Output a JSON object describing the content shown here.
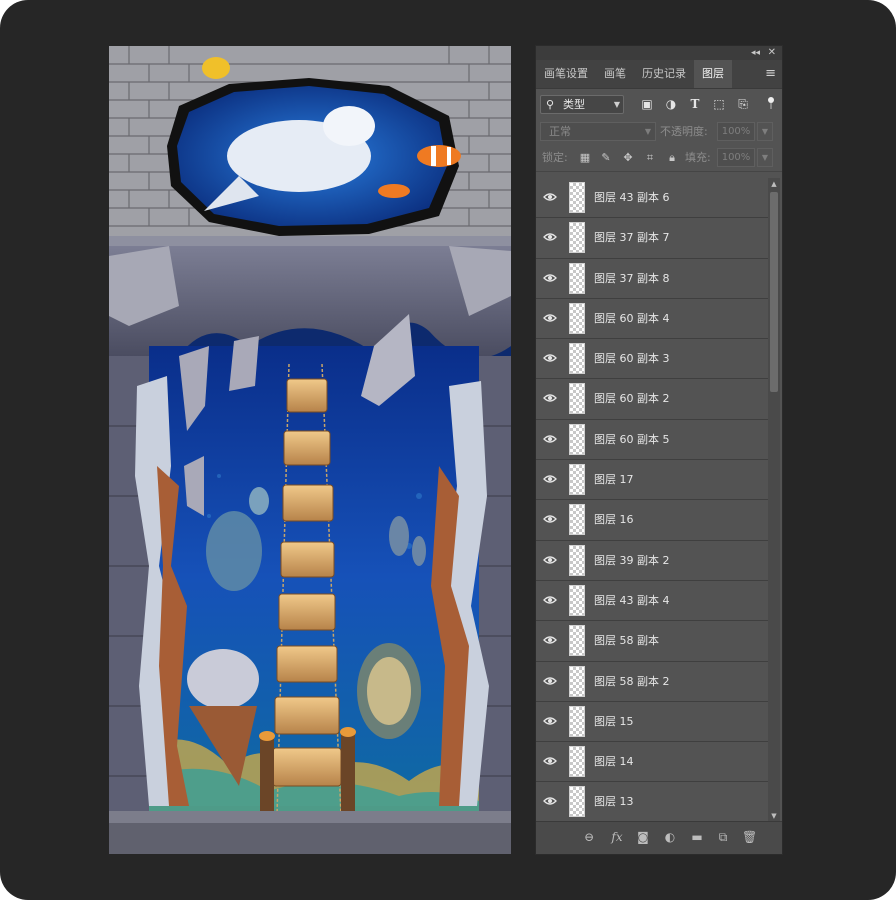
{
  "panel": {
    "tabs": [
      {
        "label": "画笔设置"
      },
      {
        "label": "画笔"
      },
      {
        "label": "历史记录"
      },
      {
        "label": "图层"
      }
    ],
    "filter": {
      "label": "类型"
    },
    "blend": {
      "mode": "正常",
      "opacity_label": "不透明度:",
      "opacity_value": "100%"
    },
    "lock": {
      "label": "锁定:",
      "fill_label": "填充:",
      "fill_value": "100%"
    },
    "layers": [
      {
        "name": "图层 43 副本 6"
      },
      {
        "name": "图层 37 副本 7"
      },
      {
        "name": "图层 37 副本 8"
      },
      {
        "name": "图层 60 副本 4"
      },
      {
        "name": "图层 60 副本 3"
      },
      {
        "name": "图层 60 副本 2"
      },
      {
        "name": "图层 60 副本 5"
      },
      {
        "name": "图层 17"
      },
      {
        "name": "图层 16"
      },
      {
        "name": "图层 39 副本 2"
      },
      {
        "name": "图层 43 副本 4"
      },
      {
        "name": "图层 58 副本"
      },
      {
        "name": "图层 58 副本 2"
      },
      {
        "name": "图层 15"
      },
      {
        "name": "图层 14"
      },
      {
        "name": "图层 13"
      }
    ]
  },
  "colors": {
    "background": "#262626",
    "panel": "#535353",
    "accent_ocean": "#1a4bb0"
  }
}
